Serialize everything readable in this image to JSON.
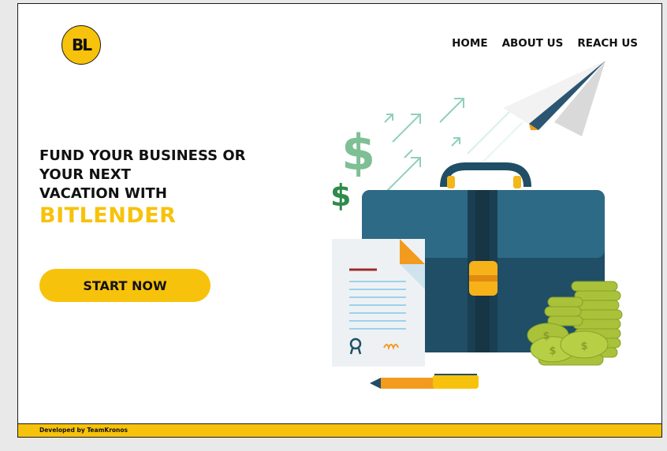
{
  "brand": {
    "logo_text": "BL"
  },
  "nav": {
    "home": "HOME",
    "about": "ABOUT US",
    "reach": "REACH US"
  },
  "hero": {
    "line1": "FUND YOUR BUSINESS OR",
    "line2": "YOUR NEXT",
    "line3": "VACATION WITH",
    "brand_name": "BITLENDER",
    "cta_label": "START NOW"
  },
  "illustration": {
    "dollar_sign": "$"
  },
  "footer": {
    "credit": "Developed by TeamKronos"
  },
  "colors": {
    "accent": "#f7c20b",
    "briefcase": "#1f4e66",
    "coins": "#a9c23a"
  }
}
